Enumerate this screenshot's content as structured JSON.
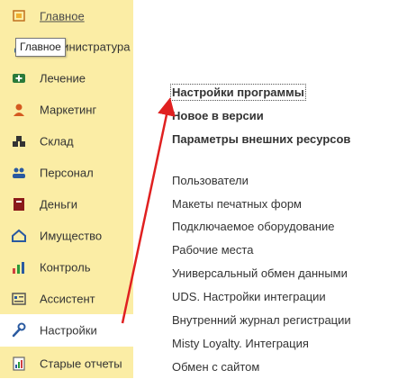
{
  "tooltip": {
    "text": "Главное"
  },
  "sidebar": {
    "items": [
      {
        "label": "Главное",
        "icon": "home-icon"
      },
      {
        "label": "Администратура",
        "icon": "admin-icon"
      },
      {
        "label": "Лечение",
        "icon": "treatment-icon"
      },
      {
        "label": "Маркетинг",
        "icon": "marketing-icon"
      },
      {
        "label": "Склад",
        "icon": "warehouse-icon"
      },
      {
        "label": "Персонал",
        "icon": "staff-icon"
      },
      {
        "label": "Деньги",
        "icon": "money-icon"
      },
      {
        "label": "Имущество",
        "icon": "property-icon"
      },
      {
        "label": "Контроль",
        "icon": "control-chart-icon"
      },
      {
        "label": "Ассистент",
        "icon": "assistant-icon"
      },
      {
        "label": "Настройки",
        "icon": "wrench-icon"
      },
      {
        "label": "Старые отчеты",
        "icon": "old-reports-icon"
      }
    ]
  },
  "content": {
    "bold_links": [
      "Настройки программы",
      "Новое в версии",
      "Параметры внешних ресурсов"
    ],
    "links": [
      "Пользователи",
      "Макеты печатных форм",
      "Подключаемое оборудование",
      "Рабочие места",
      "Универсальный обмен данными",
      "UDS. Настройки интеграции",
      "Внутренний журнал регистрации",
      "Misty Loyalty. Интеграция",
      "Обмен с сайтом"
    ]
  },
  "colors": {
    "sidebar_bg": "#fbeda5",
    "active_bg": "#ffffff",
    "arrow": "#e02020"
  }
}
